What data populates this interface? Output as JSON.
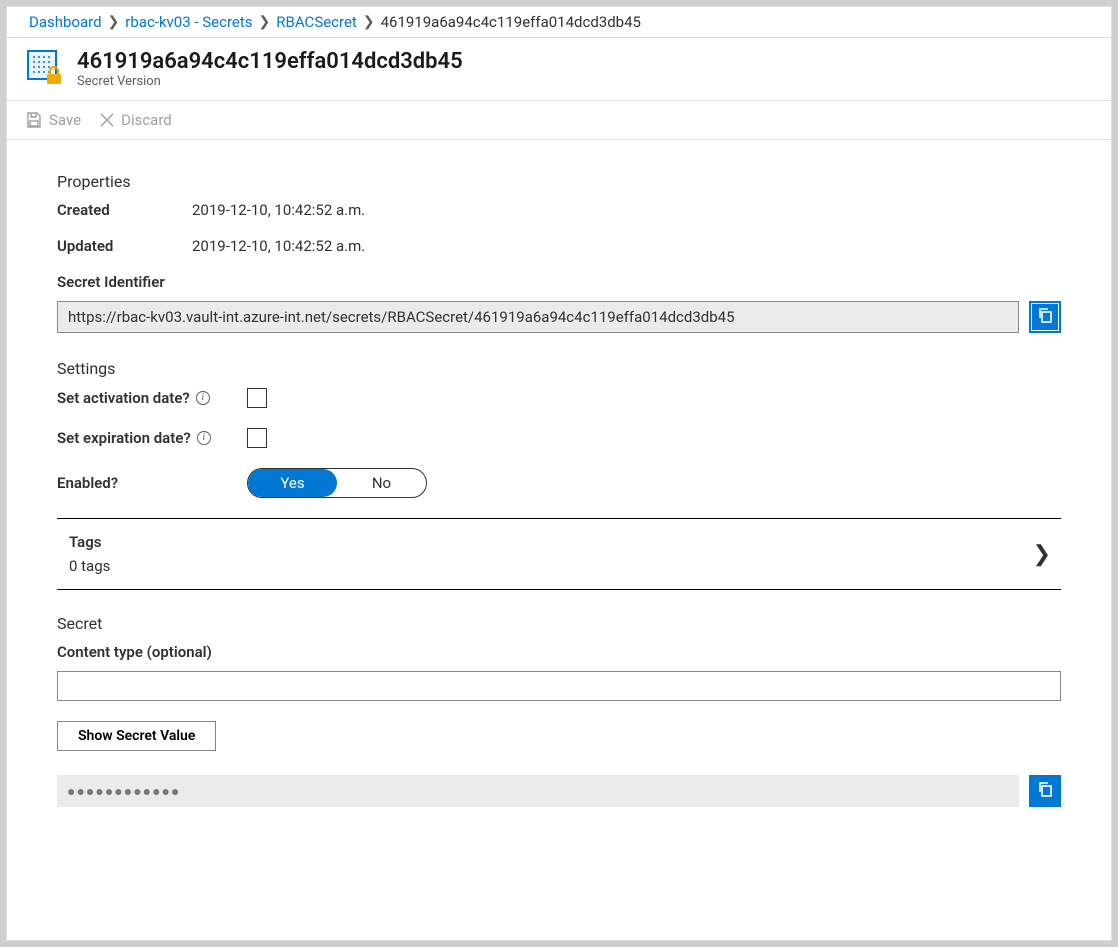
{
  "breadcrumb": {
    "items": [
      {
        "label": "Dashboard",
        "link": true
      },
      {
        "label": "rbac-kv03 - Secrets",
        "link": true
      },
      {
        "label": "RBACSecret",
        "link": true
      },
      {
        "label": "461919a6a94c4c119effa014dcd3db45",
        "link": false
      }
    ]
  },
  "header": {
    "title": "461919a6a94c4c119effa014dcd3db45",
    "subtitle": "Secret Version"
  },
  "commands": {
    "save": "Save",
    "discard": "Discard"
  },
  "properties": {
    "heading": "Properties",
    "created_label": "Created",
    "created_value": "2019-12-10, 10:42:52 a.m.",
    "updated_label": "Updated",
    "updated_value": "2019-12-10, 10:42:52 a.m.",
    "identifier_label": "Secret Identifier",
    "identifier_value": "https://rbac-kv03.vault-int.azure-int.net/secrets/RBACSecret/461919a6a94c4c119effa014dcd3db45"
  },
  "settings": {
    "heading": "Settings",
    "activation_label": "Set activation date?",
    "expiration_label": "Set expiration date?",
    "enabled_label": "Enabled?",
    "enabled_yes": "Yes",
    "enabled_no": "No"
  },
  "tags": {
    "label": "Tags",
    "count_text": "0 tags"
  },
  "secret": {
    "heading": "Secret",
    "content_type_label": "Content type (optional)",
    "content_type_value": "",
    "show_button": "Show Secret Value",
    "masked_value": "●●●●●●●●●●●●"
  }
}
